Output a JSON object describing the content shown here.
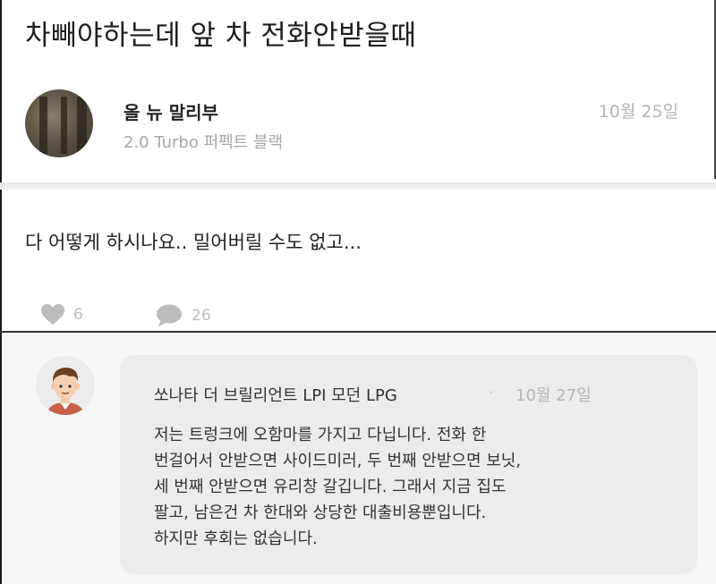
{
  "post": {
    "title": "차빼야하는데 앞 차 전화안받을때",
    "author": {
      "name": "올 뉴 말리부",
      "car": "2.0 Turbo 퍼펙트 블랙"
    },
    "date": "10월 25일",
    "body": "다 어떻게 하시나요.. 밀어버릴 수도 없고...",
    "likes": "6",
    "comments": "26"
  },
  "comment": {
    "author": "쏘나타 더 브릴리언트 LPI 모던 LPG",
    "separator": "·",
    "date": "10월 27일",
    "lines": [
      "저는 트렁크에 오함마를 가지고 다닙니다. 전화 한",
      "번걸어서 안받으면 사이드미러, 두 번째 안받으면 보닛,",
      "세 번째 안받으면 유리창 갈깁니다. 그래서 지금 집도",
      "팔고, 남은건 차 한대와 상당한 대출비용뿐입니다.",
      "하지만 후회는 없습니다."
    ]
  },
  "icons": {
    "like": "heart-icon",
    "comment": "speech-bubble-icon",
    "author_avatar": "tree-photo-avatar",
    "commenter_avatar": "cartoon-man-avatar"
  },
  "colors": {
    "meta_gray": "#b5b5b5",
    "bubble_bg": "#ececec",
    "comment_area_bg": "#f7f7f7"
  }
}
